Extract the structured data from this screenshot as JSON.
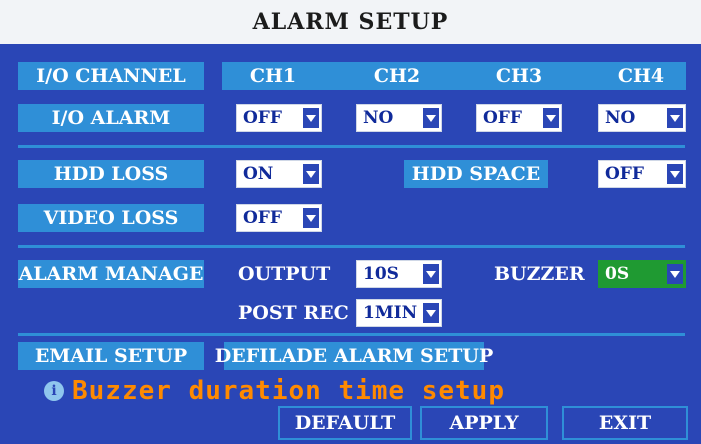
{
  "title": "ALARM SETUP",
  "io_channel": {
    "label": "I/O CHANNEL",
    "channels": [
      "CH1",
      "CH2",
      "CH3",
      "CH4"
    ]
  },
  "io_alarm": {
    "label": "I/O ALARM",
    "values": [
      "OFF",
      "NO",
      "OFF",
      "NO"
    ]
  },
  "hdd_loss": {
    "label": "HDD LOSS",
    "value": "ON"
  },
  "hdd_space": {
    "label": "HDD SPACE",
    "value": "OFF"
  },
  "video_loss": {
    "label": "VIDEO LOSS",
    "value": "OFF"
  },
  "alarm_manage": {
    "label": "ALARM MANAGE",
    "output_label": "OUTPUT",
    "output_value": "10S",
    "buzzer_label": "BUZZER",
    "buzzer_value": "0S",
    "post_rec_label": "POST REC",
    "post_rec_value": "1MIN"
  },
  "email_setup": "EMAIL SETUP",
  "defilade_alarm_setup": "DEFILADE ALARM SETUP",
  "hint": {
    "icon": "info-icon",
    "text": "Buzzer duration time setup"
  },
  "buttons": {
    "default": "DEFAULT",
    "apply": "APPLY",
    "exit": "EXIT"
  },
  "colors": {
    "panel": "#2a46b6",
    "label_bg": "#2f8fd7",
    "highlight": "#1f9a32",
    "hint": "#ff8a00"
  }
}
